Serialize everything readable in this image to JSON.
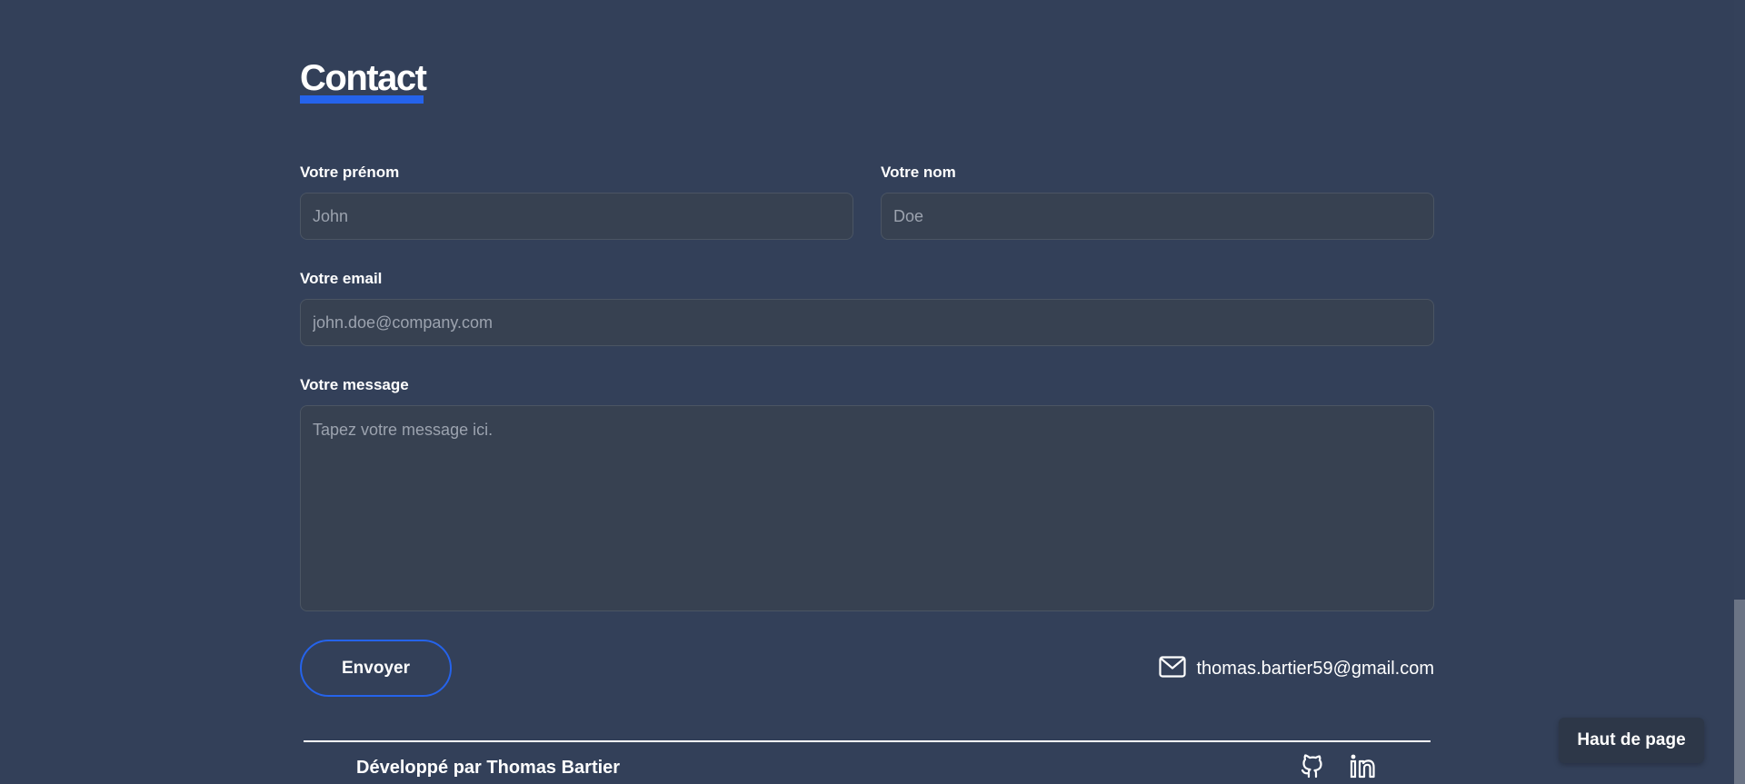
{
  "contact": {
    "title": "Contact",
    "first_name": {
      "label": "Votre prénom",
      "placeholder": "John",
      "value": ""
    },
    "last_name": {
      "label": "Votre nom",
      "placeholder": "Doe",
      "value": ""
    },
    "email": {
      "label": "Votre email",
      "placeholder": "john.doe@company.com",
      "value": ""
    },
    "message": {
      "label": "Votre message",
      "placeholder": "Tapez votre message ici.",
      "value": ""
    },
    "send_label": "Envoyer",
    "email_address": "thomas.bartier59@gmail.com"
  },
  "footer": {
    "credit": "Développé par Thomas Bartier",
    "icons": [
      "github-icon",
      "linkedin-icon"
    ]
  },
  "back_to_top_label": "Haut de page",
  "colors": {
    "background": "#334059",
    "accent": "#2563eb",
    "field_bg": "#374151",
    "field_border": "#4b5563"
  }
}
